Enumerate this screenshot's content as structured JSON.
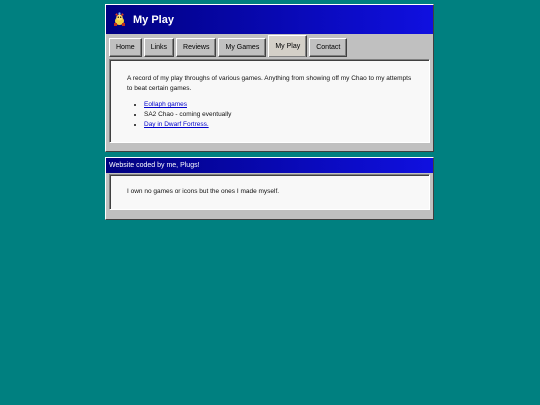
{
  "header": {
    "title": "My Play",
    "icon": "chao-icon"
  },
  "tabs": [
    {
      "label": "Home"
    },
    {
      "label": "Links"
    },
    {
      "label": "Reviews"
    },
    {
      "label": "My Games"
    },
    {
      "label": "My Play",
      "active": true
    },
    {
      "label": "Contact"
    }
  ],
  "main": {
    "intro": "A record of my play throughs of various games. Anything from showing off my Chao to my attempts to beat certain games.",
    "items": [
      {
        "label": "Eollaph games",
        "link": true
      },
      {
        "label": "SA2 Chao - coming eventually",
        "link": false
      },
      {
        "label": "Day in Dwarf Fortress.",
        "link": true
      }
    ]
  },
  "footer": {
    "title": "Website coded by me, Plugs!",
    "text": "I own no games or icons but the ones I made myself."
  },
  "colors": {
    "desktop": "#008080",
    "titlebar": "#000080",
    "window": "#c0c0c0",
    "link": "#0000cc"
  }
}
